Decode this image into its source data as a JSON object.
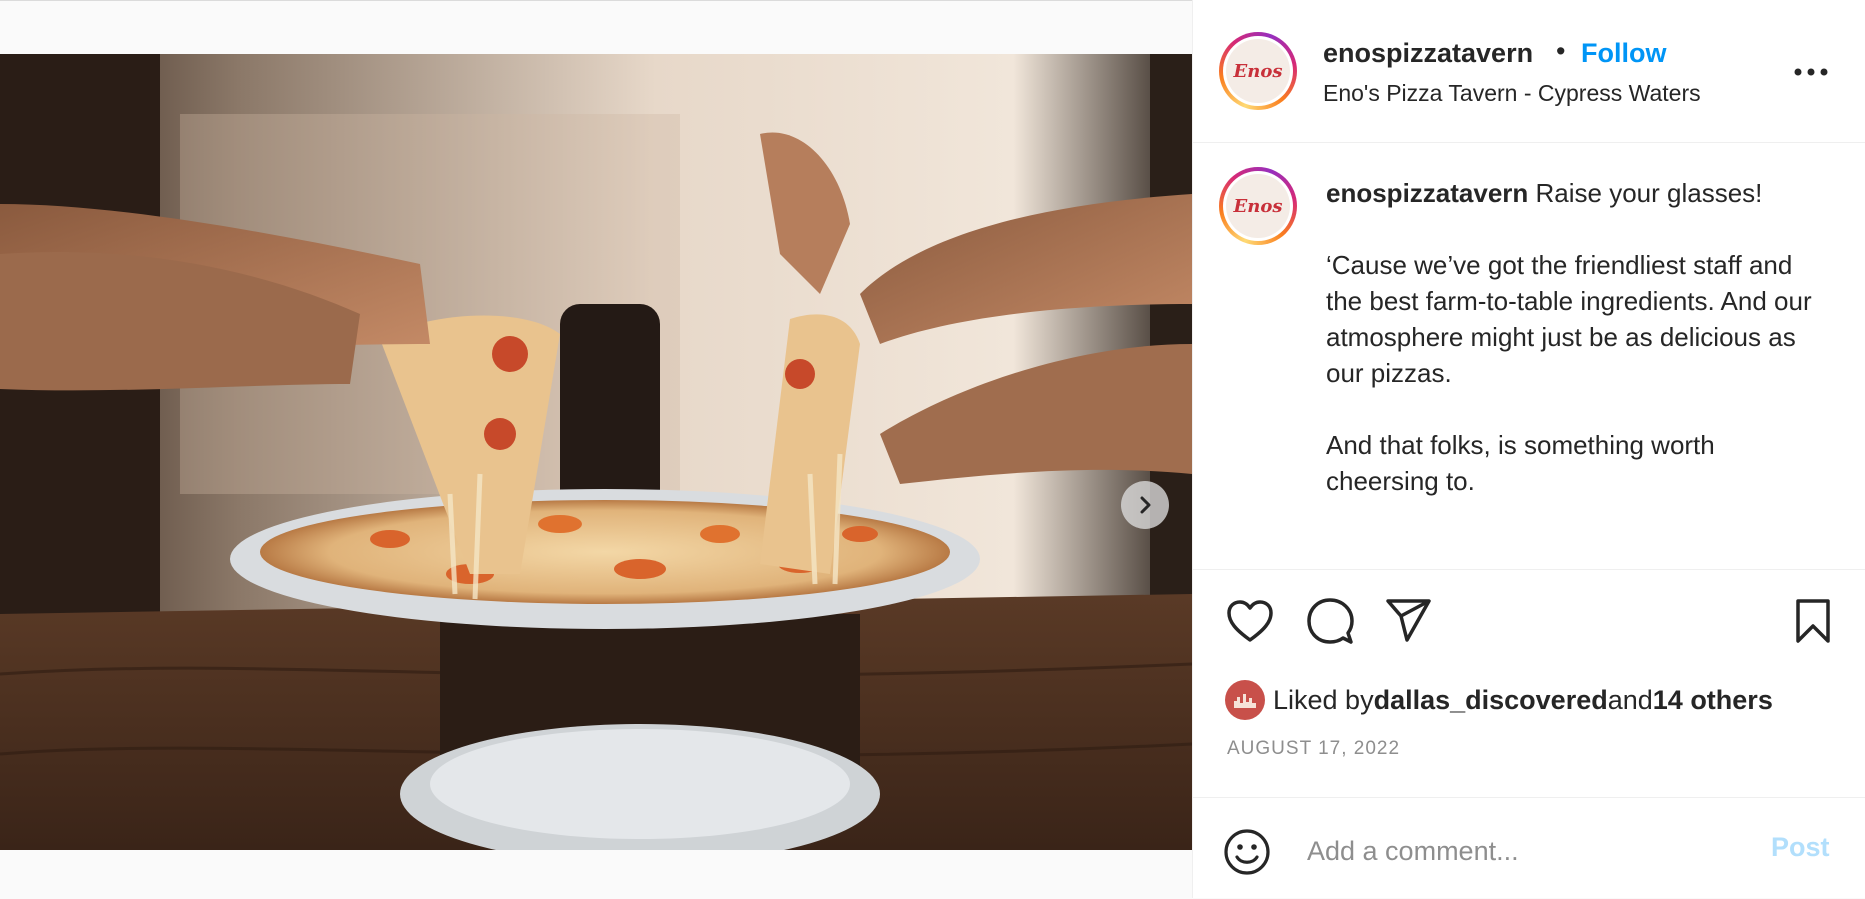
{
  "post": {
    "username": "enospizzatavern",
    "separator": "•",
    "follow_label": "Follow",
    "location": "Eno's Pizza Tavern - Cypress Waters",
    "avatar_text": "Enos",
    "more_icon": "ellipsis-icon"
  },
  "caption": {
    "username": "enospizzatavern",
    "text_1": " Raise your glasses!",
    "text_2": "‘Cause we’ve got the friendliest staff and the best farm-to-table ingredients. And our atmosphere might just be as delicious as our pizzas.",
    "text_3": "And that folks, is something worth cheersing to."
  },
  "actions": {
    "like_icon": "heart-icon",
    "comment_icon": "comment-icon",
    "share_icon": "share-icon",
    "save_icon": "bookmark-icon"
  },
  "likes": {
    "prefix": "Liked by ",
    "user": "dallas_discovered",
    "middle": " and ",
    "others": "14 others"
  },
  "date": "AUGUST 17, 2022",
  "comment": {
    "placeholder": "Add a comment...",
    "post_label": "Post"
  },
  "carousel": {
    "slide_count": 3,
    "active_index": 0
  },
  "colors": {
    "accent": "#0095f6",
    "post_disabled": "#b2dffc",
    "muted": "#8e8e8e",
    "text": "#262626"
  }
}
